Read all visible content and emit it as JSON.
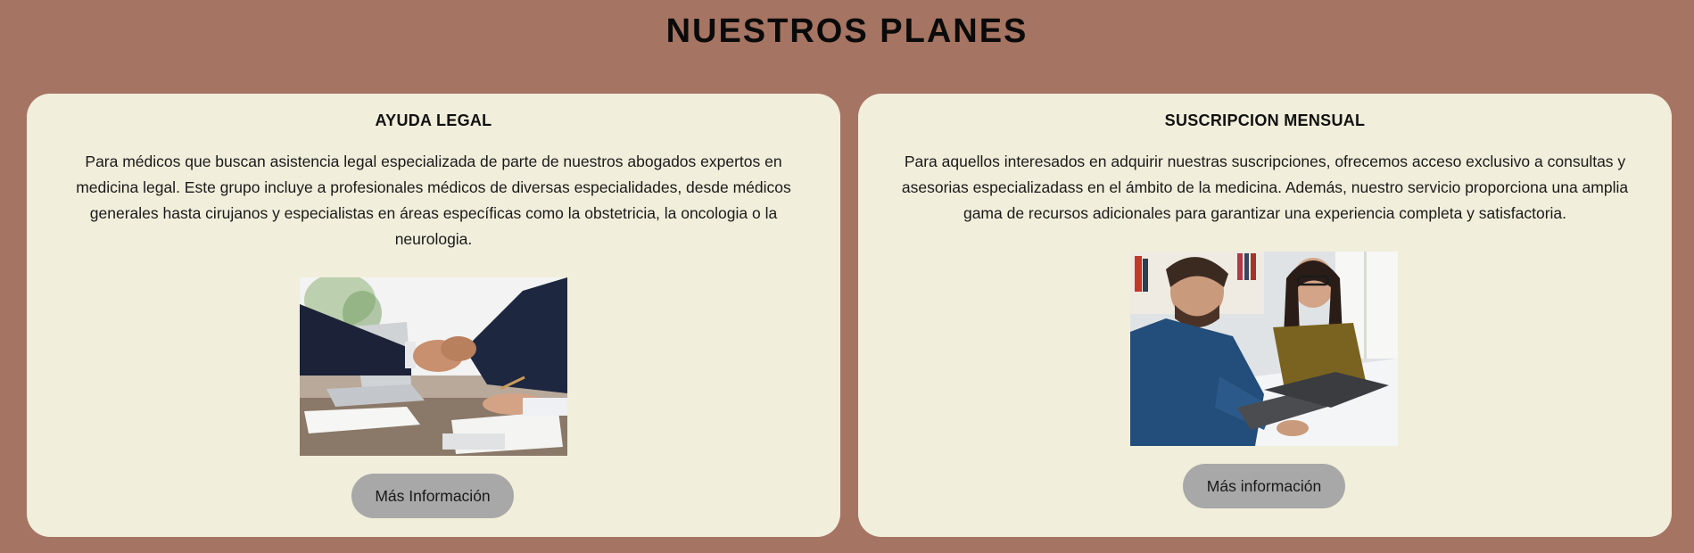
{
  "page": {
    "title": "NUESTROS PLANES"
  },
  "plans": [
    {
      "title": "AYUDA LEGAL",
      "description": "Para médicos que buscan asistencia legal especializada de parte de nuestros abogados expertos en medicina legal. Este grupo incluye a profesionales médicos de diversas especialidades, desde médicos generales hasta cirujanos y especialistas en áreas específicas como la obstetricia, la oncologia o la neurologia.",
      "image": "handshake-business-photo",
      "button_label": "Más Información"
    },
    {
      "title": "SUSCRIPCION MENSUAL",
      "description": "Para aquellos interesados en adquirir nuestras suscripciones, ofrecemos acceso exclusivo a consultas y asesorias especializadass en el ámbito de la medicina. Además, nuestro servicio proporciona una amplia gama de recursos adicionales para garantizar una experiencia completa y satisfactoria.",
      "image": "couple-with-laptop-photo",
      "button_label": "Más información"
    }
  ],
  "colors": {
    "background": "#a67462",
    "card": "#f1eedb",
    "button": "#a8a8a8"
  }
}
